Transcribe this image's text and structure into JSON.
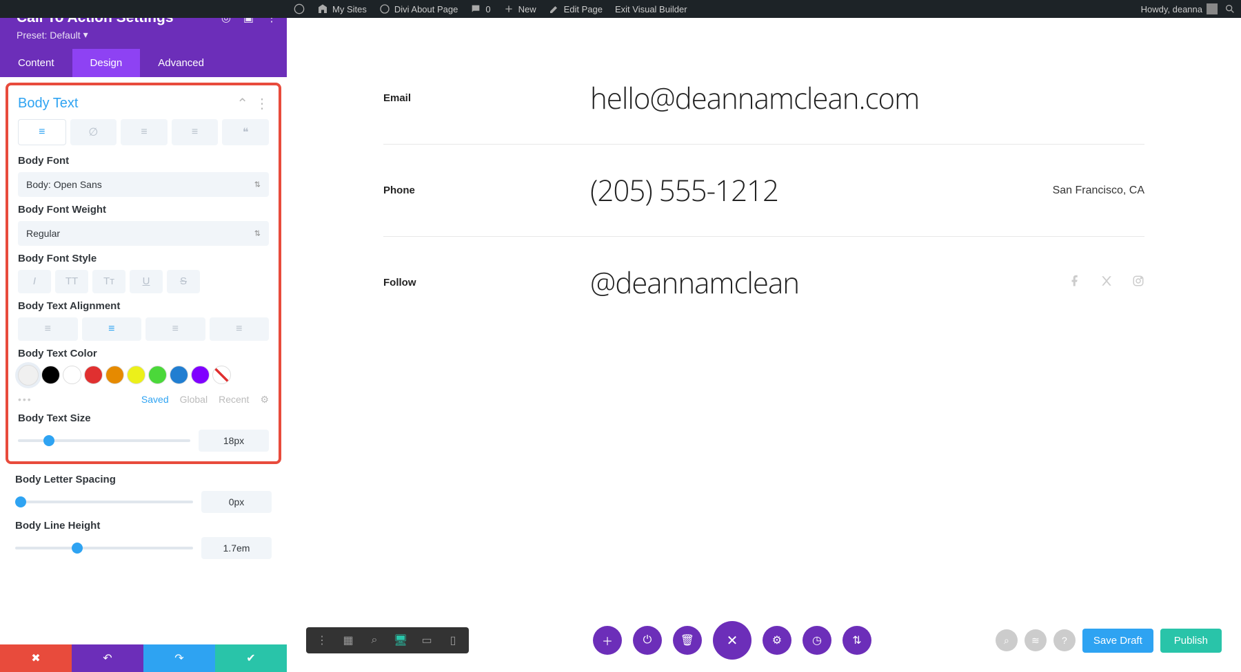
{
  "wpbar": {
    "mysites": "My Sites",
    "sitename": "Divi About Page",
    "comments": "0",
    "new": "New",
    "edit": "Edit Page",
    "exit": "Exit Visual Builder",
    "howdy": "Howdy, deanna"
  },
  "sidebar": {
    "title": "Call To Action Settings",
    "preset": "Preset: Default",
    "tabs": {
      "content": "Content",
      "design": "Design",
      "advanced": "Advanced"
    },
    "section_title": "Body Text",
    "body_font_label": "Body Font",
    "body_font_value": "Body: Open Sans",
    "body_weight_label": "Body Font Weight",
    "body_weight_value": "Regular",
    "body_style_label": "Body Font Style",
    "body_align_label": "Body Text Alignment",
    "body_color_label": "Body Text Color",
    "colors": [
      "#f0f0f0",
      "#000000",
      "#ffffff",
      "#e03030",
      "#e68a00",
      "#ecf01a",
      "#4bd83a",
      "#217ed1",
      "#8000ff"
    ],
    "color_tabs": {
      "saved": "Saved",
      "global": "Global",
      "recent": "Recent"
    },
    "size_label": "Body Text Size",
    "size_value": "18px",
    "spacing_label": "Body Letter Spacing",
    "spacing_value": "0px",
    "lineheight_label": "Body Line Height",
    "lineheight_value": "1.7em"
  },
  "canvas": {
    "rows": [
      {
        "label": "Email",
        "value": "hello@deannamclean.com",
        "extra": ""
      },
      {
        "label": "Phone",
        "value": "(205) 555-1212",
        "extra": "San Francisco, CA"
      },
      {
        "label": "Follow",
        "value": "@deannamclean",
        "extra": ""
      }
    ]
  },
  "footer": {
    "draft": "Save Draft",
    "publish": "Publish"
  }
}
